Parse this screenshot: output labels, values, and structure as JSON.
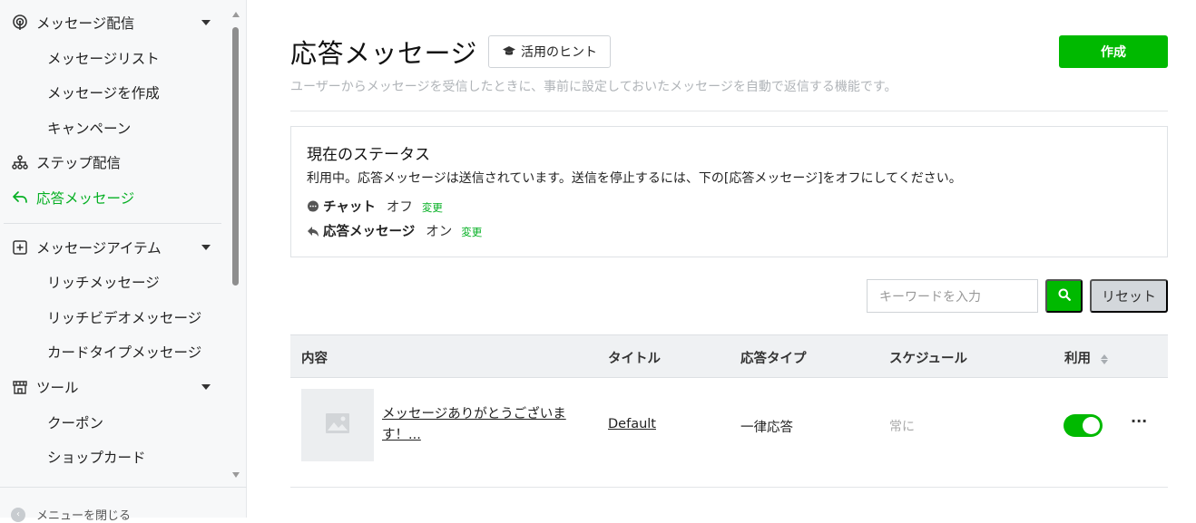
{
  "sidebar": {
    "message_delivery": "メッセージ配信",
    "message_list": "メッセージリスト",
    "create_message": "メッセージを作成",
    "campaign": "キャンペーン",
    "step_delivery": "ステップ配信",
    "auto_response": "応答メッセージ",
    "message_items": "メッセージアイテム",
    "rich_message": "リッチメッセージ",
    "rich_video": "リッチビデオメッセージ",
    "card_type": "カードタイプメッセージ",
    "tools": "ツール",
    "coupon": "クーポン",
    "shop_card": "ショップカード",
    "close_menu": "メニューを閉じる"
  },
  "header": {
    "title": "応答メッセージ",
    "hint_label": "活用のヒント",
    "create_label": "作成",
    "description": "ユーザーからメッセージを受信したときに、事前に設定しておいたメッセージを自動で返信する機能です。"
  },
  "status": {
    "title": "現在のステータス",
    "text": "利用中。応答メッセージは送信されています。送信を停止するには、下の[応答メッセージ]をオフにしてください。",
    "chat_label": "チャット",
    "chat_value": "オフ",
    "chat_change": "変更",
    "response_label": "応答メッセージ",
    "response_value": "オン",
    "response_change": "変更"
  },
  "search": {
    "placeholder": "キーワードを入力",
    "reset_label": "リセット"
  },
  "table": {
    "headers": [
      "内容",
      "タイトル",
      "応答タイプ",
      "スケジュール",
      "利用"
    ],
    "rows": [
      {
        "content": "メッセージありがとうございます！...",
        "title": "Default",
        "type": "一律応答",
        "schedule": "常に",
        "enabled": true
      }
    ]
  },
  "colors": {
    "accent": "#00b900",
    "active_text": "#06b024"
  }
}
